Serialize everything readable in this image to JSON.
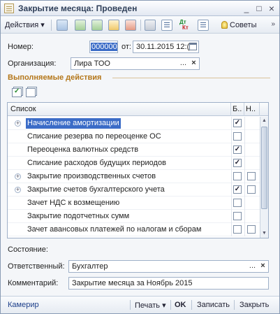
{
  "window": {
    "title": "Закрытие месяца: Проведен",
    "min_glyph": "_",
    "max_glyph": "□",
    "close_glyph": "×"
  },
  "toolbar": {
    "actions_label": "Действия",
    "dropdown_glyph": "▾",
    "dt_label": "Дт",
    "kt_label": "Кт",
    "advice_label": "Советы",
    "more_glyph": "»"
  },
  "form": {
    "number_label": "Номер:",
    "number_value": "000000",
    "from_label": "от:",
    "date_value": "30.11.2015 12:(",
    "org_label": "Организация:",
    "org_value": "Лира ТОО",
    "select_glyph": "...",
    "clear_glyph": "×"
  },
  "actions_section": {
    "title": "Выполняемые действия"
  },
  "table": {
    "headers": [
      "Список",
      "Б..",
      "Н.."
    ],
    "rows": [
      {
        "name": "Начисление амортизации",
        "expandable": true,
        "selected": true,
        "b": true,
        "n": null
      },
      {
        "name": "Списание резерва по переоценке ОС",
        "expandable": false,
        "selected": false,
        "b": false,
        "n": null
      },
      {
        "name": "Переоценка валютных средств",
        "expandable": false,
        "selected": false,
        "b": true,
        "n": null
      },
      {
        "name": "Списание расходов будущих периодов",
        "expandable": false,
        "selected": false,
        "b": true,
        "n": null
      },
      {
        "name": "Закрытие производственных счетов",
        "expandable": true,
        "selected": false,
        "b": false,
        "n": false
      },
      {
        "name": "Закрытие счетов бухгалтерского учета",
        "expandable": true,
        "selected": false,
        "b": true,
        "n": false
      },
      {
        "name": "Зачет НДС к возмещению",
        "expandable": false,
        "selected": false,
        "b": false,
        "n": null
      },
      {
        "name": "Закрытие подотчетных сумм",
        "expandable": false,
        "selected": false,
        "b": false,
        "n": null
      },
      {
        "name": "Зачет авансовых платежей по налогам и сборам",
        "expandable": false,
        "selected": false,
        "b": false,
        "n": false
      }
    ],
    "check_glyph": "✓",
    "expand_glyph": "+",
    "scroll_up_glyph": "▲",
    "scroll_down_glyph": "▼"
  },
  "footer_fields": {
    "state_label": "Состояние:",
    "responsible_label": "Ответственный:",
    "responsible_value": "Бухгалтер",
    "comment_label": "Комментарий:",
    "comment_value": "Закрытие месяца за Ноябрь 2015"
  },
  "bottombar": {
    "link_label": "Камерир",
    "print_label": "Печать",
    "ok_label": "OK",
    "save_label": "Записать",
    "close_label": "Закрыть"
  }
}
